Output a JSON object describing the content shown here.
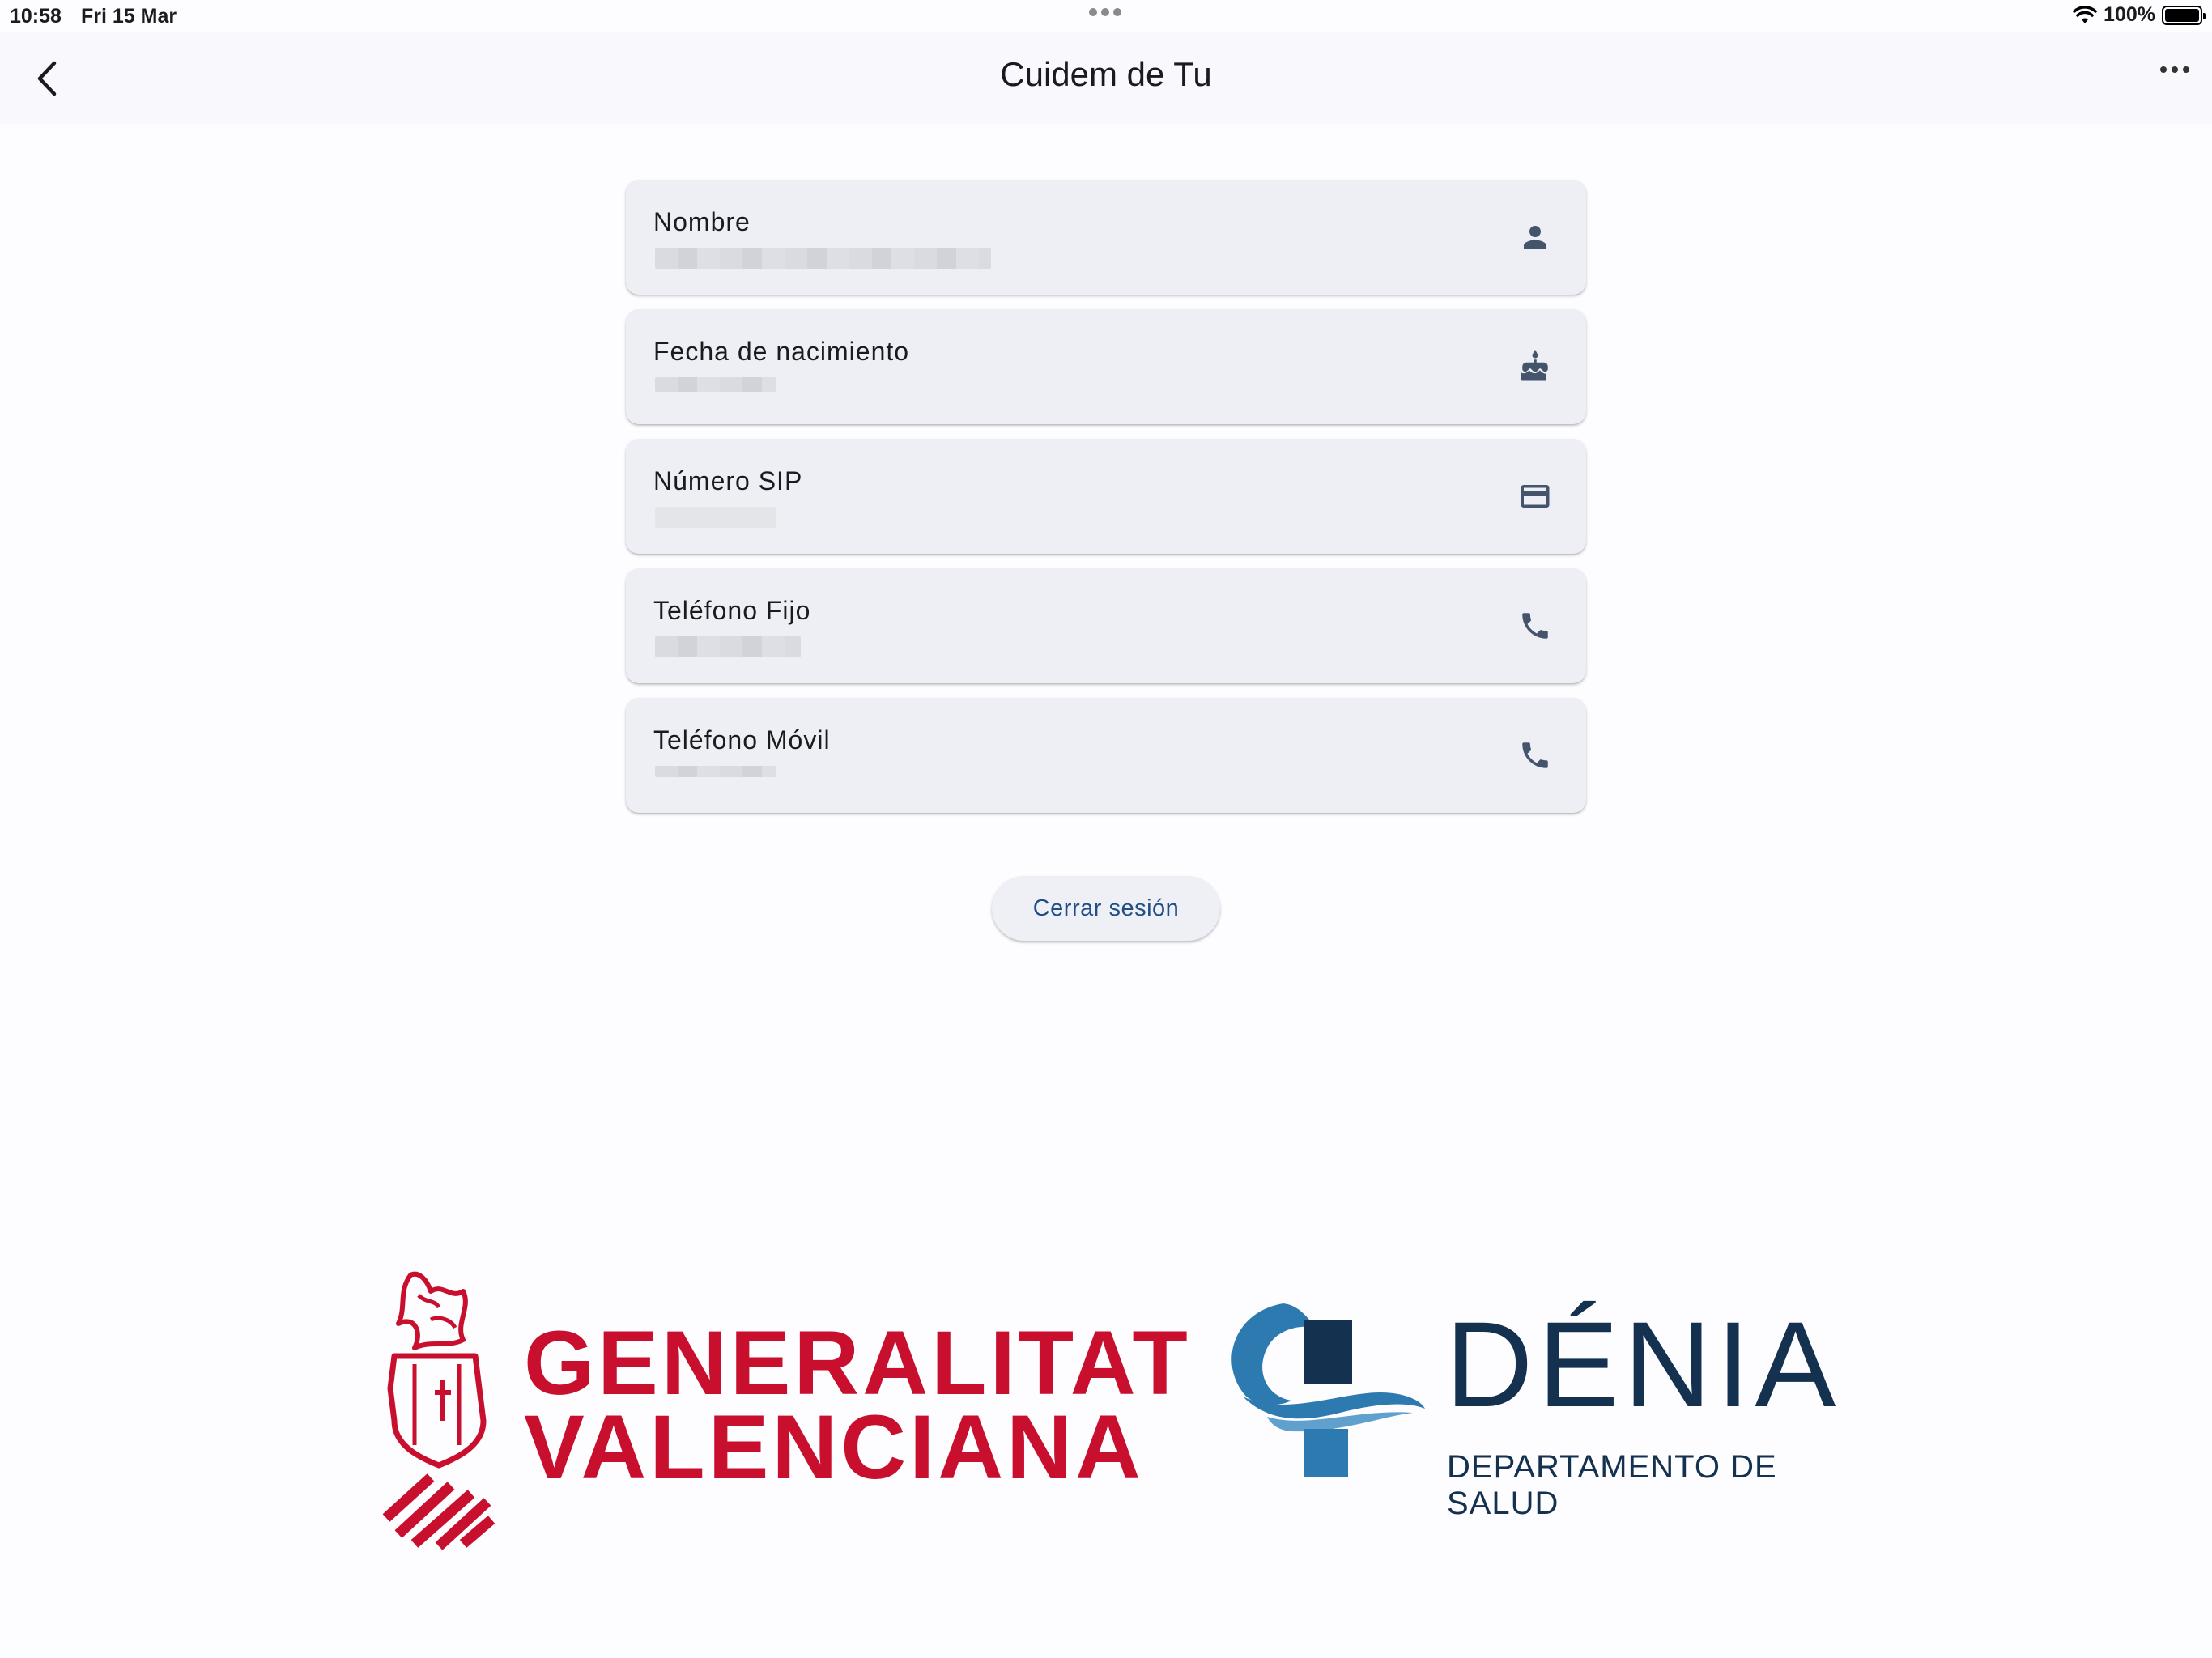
{
  "status_bar": {
    "time": "10:58",
    "date": "Fri 15 Mar",
    "battery": "100%"
  },
  "app_bar": {
    "title": "Cuidem de Tu"
  },
  "profile_fields": [
    {
      "label": "Nombre",
      "icon": "person-icon"
    },
    {
      "label": "Fecha de nacimiento",
      "icon": "cake-icon"
    },
    {
      "label": "Número SIP",
      "icon": "credit-card-icon"
    },
    {
      "label": "Teléfono Fijo",
      "icon": "phone-icon"
    },
    {
      "label": "Teléfono Móvil",
      "icon": "phone-icon"
    }
  ],
  "actions": {
    "logout_label": "Cerrar sesión"
  },
  "logos": {
    "generalitat_line1": "GENERALITAT",
    "generalitat_line2": "VALENCIANA",
    "denia_title": "DÉNIA",
    "denia_subtitle": "DEPARTAMENTO DE SALUD"
  },
  "colors": {
    "accent_text": "#1f4f86",
    "card_bg": "#edeff5",
    "generalitat_red": "#c8102e",
    "denia_navy": "#14314f",
    "denia_blue": "#2d7ab0"
  }
}
